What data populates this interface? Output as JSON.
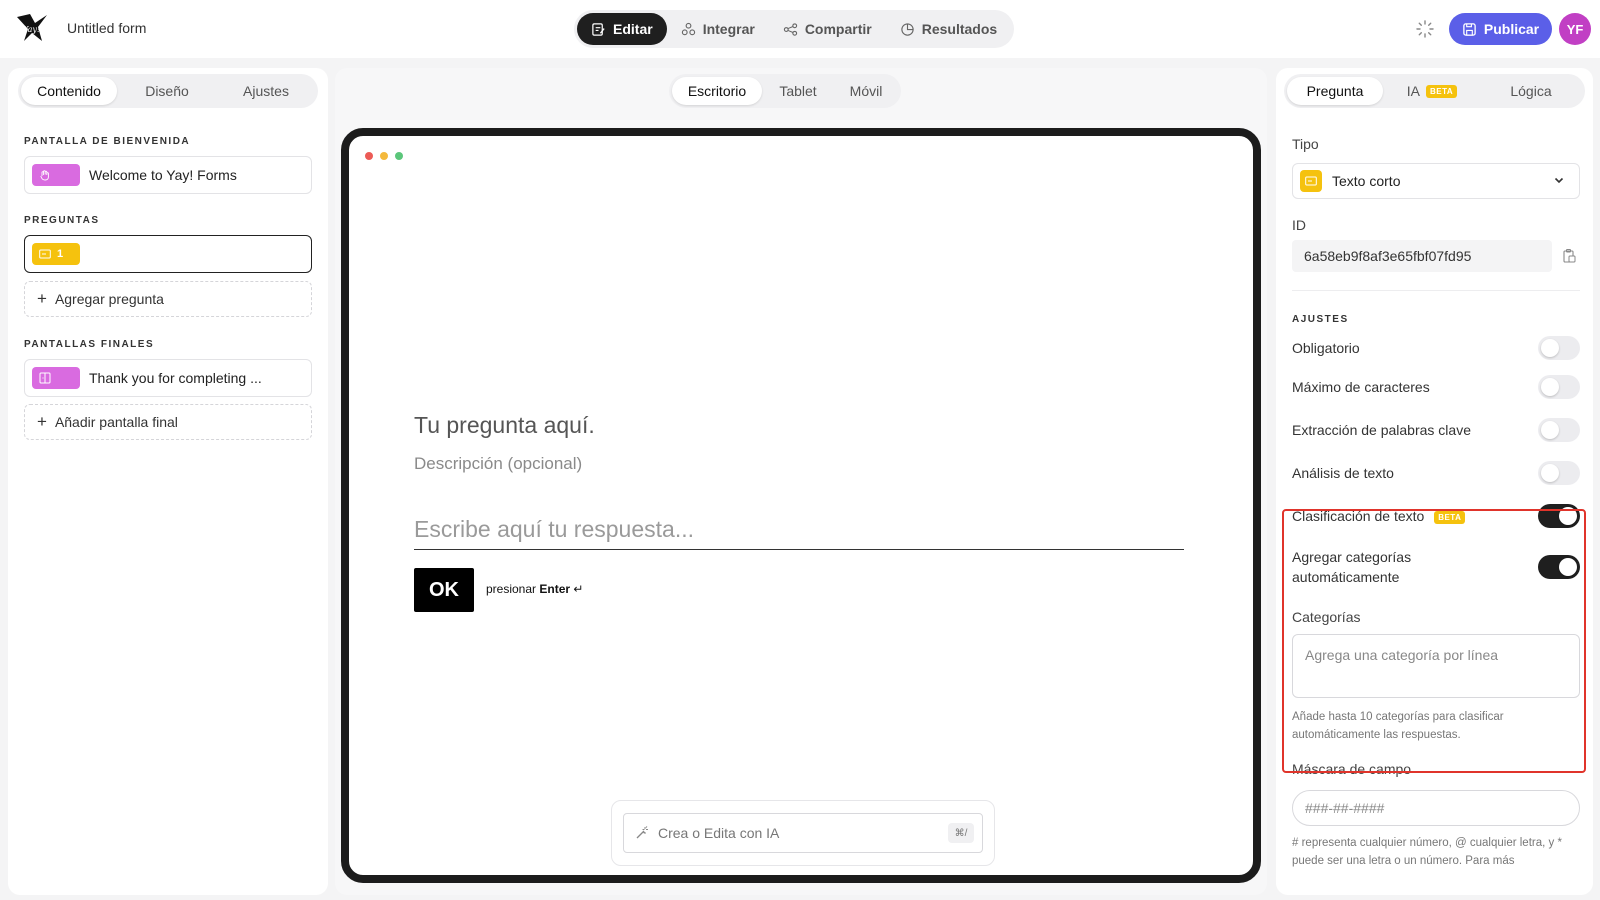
{
  "header": {
    "form_title": "Untitled form",
    "tabs": [
      {
        "label": "Editar",
        "icon": "edit-icon",
        "active": true
      },
      {
        "label": "Integrar",
        "icon": "integrate-icon",
        "active": false
      },
      {
        "label": "Compartir",
        "icon": "share-icon",
        "active": false
      },
      {
        "label": "Resultados",
        "icon": "results-icon",
        "active": false
      }
    ],
    "publish_label": "Publicar",
    "avatar_initials": "YF"
  },
  "left": {
    "tabs": [
      "Contenido",
      "Diseño",
      "Ajustes"
    ],
    "welcome_label": "PANTALLA DE BIENVENIDA",
    "welcome_item": "Welcome to Yay! Forms",
    "questions_label": "PREGUNTAS",
    "question_number": "1",
    "add_question": "Agregar pregunta",
    "endings_label": "PANTALLAS FINALES",
    "ending_item": "Thank you for completing ...",
    "add_ending": "Añadir pantalla final"
  },
  "center": {
    "devices": [
      "Escritorio",
      "Tablet",
      "Móvil"
    ],
    "question_title": "Tu pregunta aquí.",
    "question_desc": "Descripción (opcional)",
    "answer_placeholder": "Escribe aquí tu respuesta...",
    "ok_label": "OK",
    "hint_prefix": "presionar",
    "hint_key": "Enter",
    "hint_symbol": "↵",
    "ai_placeholder": "Crea o Edita con IA",
    "ai_shortcut": "⌘/"
  },
  "right": {
    "tabs": [
      "Pregunta",
      "IA",
      "Lógica"
    ],
    "beta": "BETA",
    "tipo_label": "Tipo",
    "tipo_value": "Texto corto",
    "id_label": "ID",
    "id_value": "6a58eb9f8af3e65fbf07fd95",
    "settings_label": "AJUSTES",
    "toggles": [
      {
        "label": "Obligatorio",
        "on": false
      },
      {
        "label": "Máximo de caracteres",
        "on": false
      },
      {
        "label": "Extracción de palabras clave",
        "on": false
      },
      {
        "label": "Análisis de texto",
        "on": false
      },
      {
        "label": "Clasificación de texto",
        "on": true
      },
      {
        "label": "Agregar categorías automáticamente",
        "on": true
      }
    ],
    "categories_label": "Categorías",
    "categories_placeholder": "Agrega una categoría por línea",
    "categories_help": "Añade hasta 10 categorías para clasificar automáticamente las respuestas.",
    "mask_label": "Máscara de campo",
    "mask_placeholder": "###-##-####",
    "mask_help": "# representa cualquier número, @ cualquier letra, y * puede ser una letra o un número. Para más"
  },
  "colors": {
    "accent": "#5b5fe8",
    "avatar": "#c13fc4",
    "chip_yellow": "#f5c20e",
    "chip_pink": "#d96be0",
    "highlight": "#e0342b"
  }
}
